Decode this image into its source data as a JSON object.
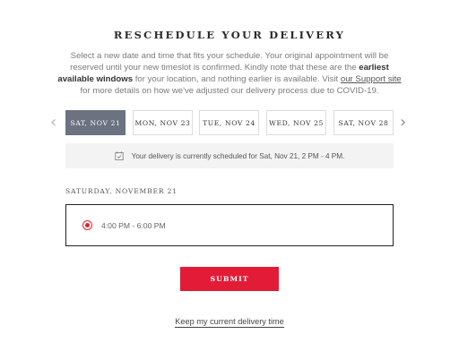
{
  "page": {
    "title": "RESCHEDULE YOUR DELIVERY",
    "intro": {
      "part1": "Select a new date and time that fits your schedule. Your original appointment will be reserved until your new timeslot is confirmed. Kindly note that these are the ",
      "bold": "earliest available windows",
      "part2": " for your location, and nothing earlier is available. Visit ",
      "link": "our Support site",
      "part3": " for more details on how we've adjusted our delivery process due to COVID-19."
    }
  },
  "date_picker": {
    "prev_icon": "chevron-left-icon",
    "next_icon": "chevron-right-icon",
    "dates": [
      {
        "label": "SAT, NOV 21",
        "selected": true
      },
      {
        "label": "MON, NOV 23",
        "selected": false
      },
      {
        "label": "TUE, NOV 24",
        "selected": false
      },
      {
        "label": "WED, NOV 25",
        "selected": false
      },
      {
        "label": "SAT, NOV 28",
        "selected": false
      }
    ]
  },
  "status": {
    "icon": "calendar-check-icon",
    "text": "Your delivery is currently scheduled for Sat, Nov 21, 2 PM - 4 PM."
  },
  "timeslots": {
    "day_heading": "SATURDAY, NOVEMBER 21",
    "slots": [
      {
        "label": "4:00 PM - 6:00 PM",
        "selected": true
      }
    ]
  },
  "actions": {
    "submit_label": "SUBMIT",
    "keep_label": "Keep my current delivery time"
  },
  "colors": {
    "accent": "#e21c37",
    "selected_date": "#6b7280",
    "status_bg": "#f3f3f3"
  }
}
